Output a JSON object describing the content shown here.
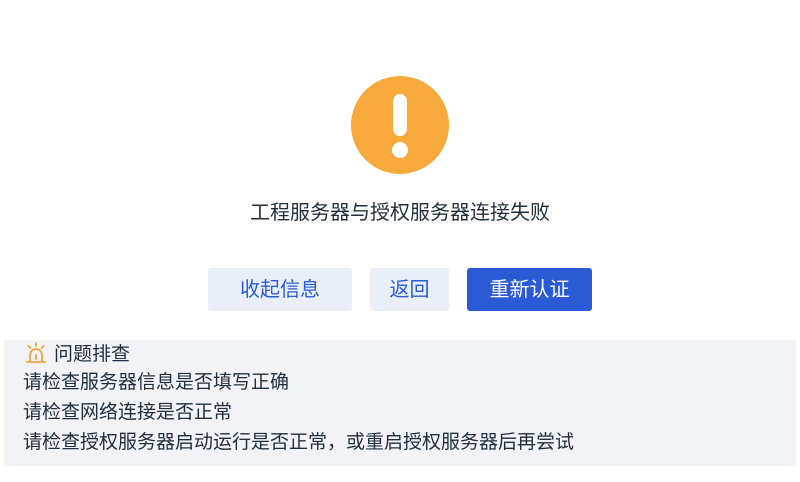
{
  "status": {
    "icon": "exclamation-circle-icon",
    "icon_color": "#f7a93b",
    "message": "工程服务器与授权服务器连接失败"
  },
  "actions": {
    "collapse_label": "收起信息",
    "back_label": "返回",
    "reauth_label": "重新认证",
    "primary_color": "#2a5ad6",
    "secondary_bg": "#e9eef9"
  },
  "troubleshooting": {
    "icon": "alarm-bell-icon",
    "title": "问题排查",
    "items": [
      "请检查服务器信息是否填写正确",
      "请检查网络连接是否正常",
      "请检查授权服务器启动运行是否正常，或重启授权服务器后再尝试"
    ]
  }
}
